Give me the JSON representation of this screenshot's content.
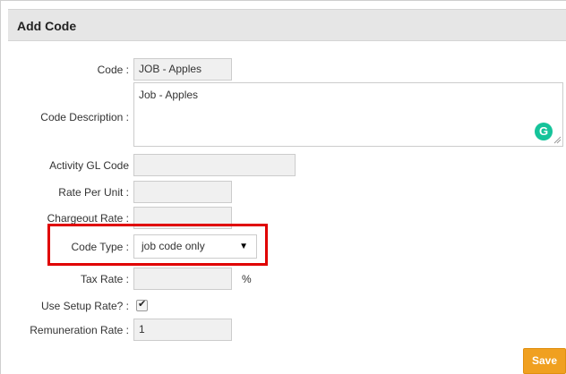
{
  "panel": {
    "title": "Add Code"
  },
  "form": {
    "code": {
      "label": "Code :",
      "value": "JOB - Apples"
    },
    "code_description": {
      "label": "Code Description :",
      "value": "Job - Apples"
    },
    "activity_gl_code": {
      "label": "Activity GL Code",
      "value": ""
    },
    "rate_per_unit": {
      "label": "Rate Per Unit :",
      "value": ""
    },
    "chargeout_rate": {
      "label": "Chargeout Rate :",
      "value": ""
    },
    "code_type": {
      "label": "Code Type :",
      "selected": "job code only"
    },
    "tax_rate": {
      "label": "Tax Rate :",
      "value": "",
      "unit": "%"
    },
    "use_setup_rate": {
      "label": "Use Setup Rate? :",
      "checked": true
    },
    "remuneration_rate": {
      "label": "Remuneration Rate :",
      "value": "1"
    }
  },
  "buttons": {
    "save_label": "Save"
  },
  "colors": {
    "accent": "#f0a020",
    "highlight": "#e00000",
    "header_bg": "#e6e6e6"
  },
  "icons": {
    "grammarly": "grammarly-icon",
    "dropdown": "chevron-down-icon",
    "check": "check-icon"
  }
}
